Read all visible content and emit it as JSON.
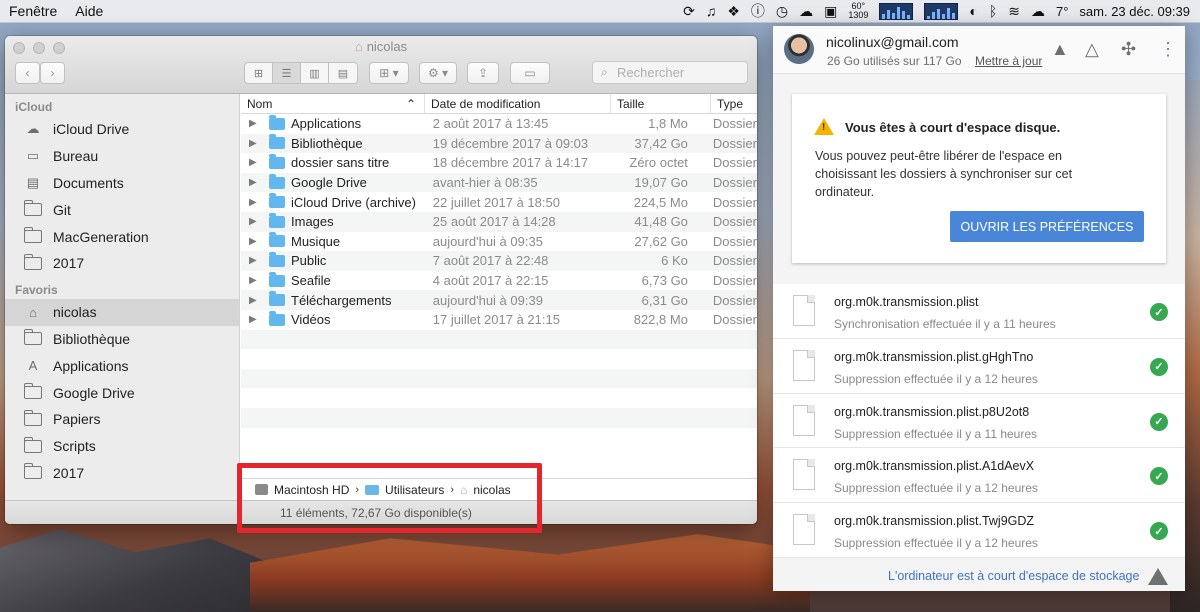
{
  "menubar": {
    "items": [
      "Fenêtre",
      "Aide"
    ],
    "cpu_label": "60°",
    "rpm_label": "1309",
    "temperature": "7°",
    "datetime": "sam. 23 déc. 09:39"
  },
  "finder": {
    "window_title": "nicolas",
    "search_placeholder": "Rechercher",
    "sidebar": {
      "sections": [
        {
          "title": "iCloud",
          "items": [
            "iCloud Drive",
            "Bureau",
            "Documents",
            "Git",
            "MacGeneration",
            "2017"
          ]
        },
        {
          "title": "Favoris",
          "items": [
            "nicolas",
            "Bibliothèque",
            "Applications",
            "Google Drive",
            "Papiers",
            "Scripts",
            "2017"
          ]
        }
      ],
      "selected": "nicolas"
    },
    "columns": [
      "Nom",
      "Date de modification",
      "Taille",
      "Type"
    ],
    "rows": [
      {
        "name": "Applications",
        "date": "2 août 2017 à 13:45",
        "size": "1,8 Mo",
        "type": "Dossier"
      },
      {
        "name": "Bibliothèque",
        "date": "19 décembre 2017 à 09:03",
        "size": "37,42 Go",
        "type": "Dossier"
      },
      {
        "name": "dossier sans titre",
        "date": "18 décembre 2017 à 14:17",
        "size": "Zéro octet",
        "type": "Dossier"
      },
      {
        "name": "Google Drive",
        "date": "avant-hier à 08:35",
        "size": "19,07 Go",
        "type": "Dossier"
      },
      {
        "name": "iCloud Drive (archive)",
        "date": "22 juillet 2017 à 18:50",
        "size": "224,5 Mo",
        "type": "Dossier"
      },
      {
        "name": "Images",
        "date": "25 août 2017 à 14:28",
        "size": "41,48 Go",
        "type": "Dossier"
      },
      {
        "name": "Musique",
        "date": "aujourd'hui à 09:35",
        "size": "27,62 Go",
        "type": "Dossier"
      },
      {
        "name": "Public",
        "date": "7 août 2017 à 22:48",
        "size": "6 Ko",
        "type": "Dossier"
      },
      {
        "name": "Seafile",
        "date": "4 août 2017 à 22:15",
        "size": "6,73 Go",
        "type": "Dossier"
      },
      {
        "name": "Téléchargements",
        "date": "aujourd'hui à 09:39",
        "size": "6,31 Go",
        "type": "Dossier"
      },
      {
        "name": "Vidéos",
        "date": "17 juillet 2017 à 21:15",
        "size": "822,8 Mo",
        "type": "Dossier"
      }
    ],
    "path": [
      "Macintosh HD",
      "Utilisateurs",
      "nicolas"
    ],
    "status": "11 éléments, 72,67 Go disponible(s)",
    "highlight_color": "#e3262d"
  },
  "drive": {
    "email": "nicolinux@gmail.com",
    "usage": "26 Go utilisés sur 117 Go",
    "upgrade": "Mettre à jour",
    "warning_title": "Vous êtes à court d'espace disque.",
    "warning_body": "Vous pouvez peut-être libérer de l'espace en choisissant les dossiers à synchroniser sur cet ordinateur.",
    "button_label": "OUVRIR LES PRÉFÉRENCES",
    "files": [
      {
        "name": "org.m0k.transmission.plist",
        "status": "Synchronisation effectuée il y a 11 heures"
      },
      {
        "name": "org.m0k.transmission.plist.gHghTno",
        "status": "Suppression effectuée il y a 12 heures"
      },
      {
        "name": "org.m0k.transmission.plist.p8U2ot8",
        "status": "Suppression effectuée il y a 11 heures"
      },
      {
        "name": "org.m0k.transmission.plist.A1dAevX",
        "status": "Suppression effectuée il y a 12 heures"
      },
      {
        "name": "org.m0k.transmission.plist.Twj9GDZ",
        "status": "Suppression effectuée il y a 12 heures"
      }
    ],
    "footer": "L'ordinateur est à court d'espace de stockage",
    "accent_color": "#4a86d8",
    "ok_color": "#36a852"
  }
}
